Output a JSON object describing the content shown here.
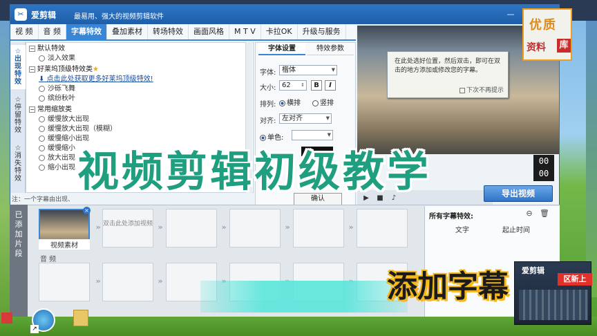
{
  "window": {
    "app_name": "爱剪辑",
    "slogan": "最易用、强大的视频剪辑软件",
    "logo_letter": "✂"
  },
  "tabs": [
    {
      "label": "视  频"
    },
    {
      "label": "音  频"
    },
    {
      "label": "字幕特效",
      "active": true
    },
    {
      "label": "叠加素材"
    },
    {
      "label": "转场特效"
    },
    {
      "label": "画面风格"
    },
    {
      "label": "M T V"
    },
    {
      "label": "卡拉OK"
    },
    {
      "label": "升级与服务"
    }
  ],
  "vnav": [
    {
      "label": "出现特效",
      "active": true
    },
    {
      "label": "停留特效"
    },
    {
      "label": "消失特效"
    }
  ],
  "effects": {
    "cat1": "默认特效",
    "cat1_items": [
      "淡入效果"
    ],
    "cat2": "好莱坞顶级特效类",
    "download_link": "点击此处获取更多好莱坞顶级特效!",
    "cat2_items": [
      "沙砾飞舞",
      "缤纷秋叶"
    ],
    "cat3": "常用缩放类",
    "cat3_items": [
      "缓慢放大出现",
      "缓慢放大出现（模糊）",
      "缓慢缩小出现",
      "缓慢缩小",
      "放大出现",
      "缩小出现"
    ]
  },
  "note": "注：一个字幕由出现、",
  "settings": {
    "tab_font": "字体设置",
    "tab_effect": "特效参数",
    "font_label": "字体:",
    "font_value": "楷体",
    "size_label": "大小:",
    "size_value": "62",
    "bold": "B",
    "italic": "I",
    "layout_label": "排列:",
    "layout_h": "横排",
    "layout_v": "竖排",
    "align_label": "对齐:",
    "align_value": "左对齐",
    "color_label": "单色:"
  },
  "preview": {
    "hint_text": "在此处选好位置，然后双击，即可在双击的地方添加或修改您的字幕。",
    "hint_checkbox": "下次不再提示"
  },
  "timecode": [
    "00",
    "00"
  ],
  "export_button": "导出视频",
  "confirm_button": "确认",
  "timeline": {
    "side_label": "已添加片段",
    "first_clip_label": "视频素材",
    "empty_hint": "双击此处添加视频",
    "audio_label": "音  频"
  },
  "fx_panel": {
    "title": "所有字幕特效:",
    "col_text": "文字",
    "col_start": "起止时间"
  },
  "overlay": {
    "big_title": "视频剪辑初级教学",
    "badge_1": "优质",
    "badge_2": "资料",
    "badge_3": "库",
    "sub_title": "添加字幕",
    "corner_logo": "爱剪辑",
    "corner_text": "区新上"
  },
  "colors": {
    "accent": "#3a86d6",
    "title_green": "#1f9f7f",
    "subtitle_yellow": "#f5b81a"
  }
}
